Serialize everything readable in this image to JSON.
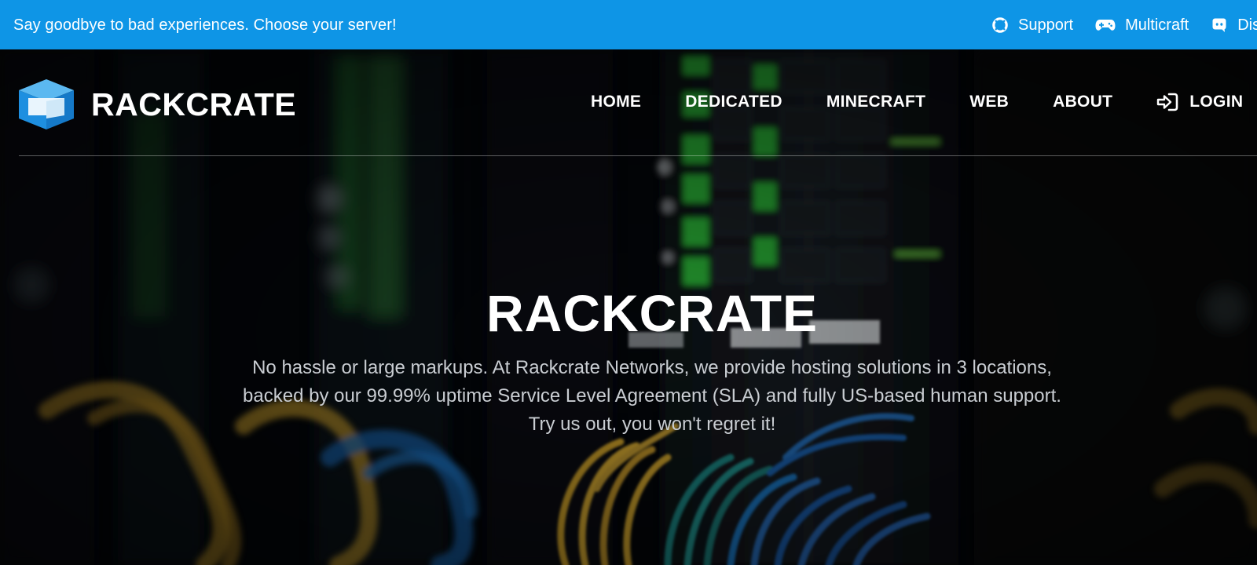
{
  "topbar": {
    "message": "Say goodbye to bad experiences. Choose your server!",
    "links": [
      {
        "label": "Support",
        "icon": "lifebuoy-icon"
      },
      {
        "label": "Multicraft",
        "icon": "gamepad-icon"
      },
      {
        "label": "Discord",
        "icon": "discord-icon"
      }
    ],
    "background_color": "#0e95e6"
  },
  "header": {
    "brand": "RACKCRATE",
    "logo_colors": [
      "#1e8fe0",
      "#ffffff",
      "#5bb8f0"
    ],
    "nav": [
      {
        "label": "HOME"
      },
      {
        "label": "DEDICATED"
      },
      {
        "label": "MINECRAFT"
      },
      {
        "label": "WEB"
      },
      {
        "label": "ABOUT"
      },
      {
        "label": "LOGIN",
        "icon": "sign-in-icon"
      }
    ]
  },
  "hero": {
    "title": "RACKCRATE",
    "description_lines": [
      "No hassle or large markups. At Rackcrate Networks, we provide hosting solutions in 3 locations,",
      "backed by our 99.99% uptime Service Level Agreement (SLA) and fully US-based human support.",
      "Try us out, you won't regret it!"
    ],
    "background_image": "server-rack-network-cables-photo"
  }
}
